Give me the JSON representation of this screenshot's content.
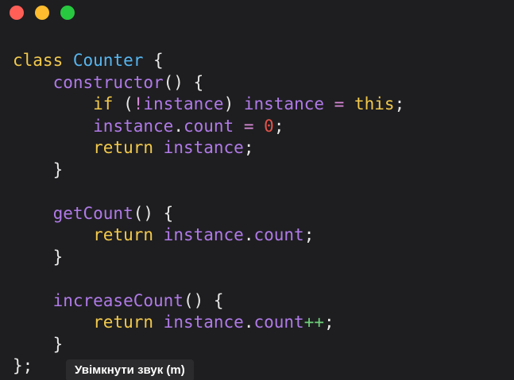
{
  "window": {
    "controls": [
      {
        "name": "close",
        "color": "#ff5f57"
      },
      {
        "name": "minimize",
        "color": "#febc2e"
      },
      {
        "name": "maximize",
        "color": "#28c840"
      }
    ]
  },
  "code": {
    "language": "javascript",
    "lines": [
      [
        {
          "t": "class",
          "c": "kw"
        },
        {
          "t": " ",
          "c": "pn"
        },
        {
          "t": "Counter",
          "c": "ty"
        },
        {
          "t": " {",
          "c": "pn"
        }
      ],
      [
        {
          "t": "    ",
          "c": "pn"
        },
        {
          "t": "constructor",
          "c": "fn"
        },
        {
          "t": "() {",
          "c": "pn"
        }
      ],
      [
        {
          "t": "        ",
          "c": "pn"
        },
        {
          "t": "if",
          "c": "kw"
        },
        {
          "t": " (",
          "c": "pn"
        },
        {
          "t": "!",
          "c": "op"
        },
        {
          "t": "instance",
          "c": "vr"
        },
        {
          "t": ") ",
          "c": "pn"
        },
        {
          "t": "instance",
          "c": "vr"
        },
        {
          "t": " ",
          "c": "pn"
        },
        {
          "t": "=",
          "c": "op"
        },
        {
          "t": " ",
          "c": "pn"
        },
        {
          "t": "this",
          "c": "th"
        },
        {
          "t": ";",
          "c": "pn"
        }
      ],
      [
        {
          "t": "        ",
          "c": "pn"
        },
        {
          "t": "instance",
          "c": "vr"
        },
        {
          "t": ".",
          "c": "pn"
        },
        {
          "t": "count",
          "c": "vr"
        },
        {
          "t": " ",
          "c": "pn"
        },
        {
          "t": "=",
          "c": "op"
        },
        {
          "t": " ",
          "c": "pn"
        },
        {
          "t": "0",
          "c": "num"
        },
        {
          "t": ";",
          "c": "pn"
        }
      ],
      [
        {
          "t": "        ",
          "c": "pn"
        },
        {
          "t": "return",
          "c": "kw"
        },
        {
          "t": " ",
          "c": "pn"
        },
        {
          "t": "instance",
          "c": "vr"
        },
        {
          "t": ";",
          "c": "pn"
        }
      ],
      [
        {
          "t": "    }",
          "c": "pn"
        }
      ],
      [],
      [
        {
          "t": "    ",
          "c": "pn"
        },
        {
          "t": "getCount",
          "c": "fn"
        },
        {
          "t": "() {",
          "c": "pn"
        }
      ],
      [
        {
          "t": "        ",
          "c": "pn"
        },
        {
          "t": "return",
          "c": "kw"
        },
        {
          "t": " ",
          "c": "pn"
        },
        {
          "t": "instance",
          "c": "vr"
        },
        {
          "t": ".",
          "c": "pn"
        },
        {
          "t": "count",
          "c": "vr"
        },
        {
          "t": ";",
          "c": "pn"
        }
      ],
      [
        {
          "t": "    }",
          "c": "pn"
        }
      ],
      [],
      [
        {
          "t": "    ",
          "c": "pn"
        },
        {
          "t": "increaseCount",
          "c": "fn"
        },
        {
          "t": "() {",
          "c": "pn"
        }
      ],
      [
        {
          "t": "        ",
          "c": "pn"
        },
        {
          "t": "return",
          "c": "kw"
        },
        {
          "t": " ",
          "c": "pn"
        },
        {
          "t": "instance",
          "c": "vr"
        },
        {
          "t": ".",
          "c": "pn"
        },
        {
          "t": "count",
          "c": "vr"
        },
        {
          "t": "++",
          "c": "inc"
        },
        {
          "t": ";",
          "c": "pn"
        }
      ],
      [
        {
          "t": "    }",
          "c": "pn"
        }
      ],
      [
        {
          "t": "};",
          "c": "pn"
        }
      ]
    ]
  },
  "tooltip": {
    "text": "Увімкнути звук (m)"
  }
}
